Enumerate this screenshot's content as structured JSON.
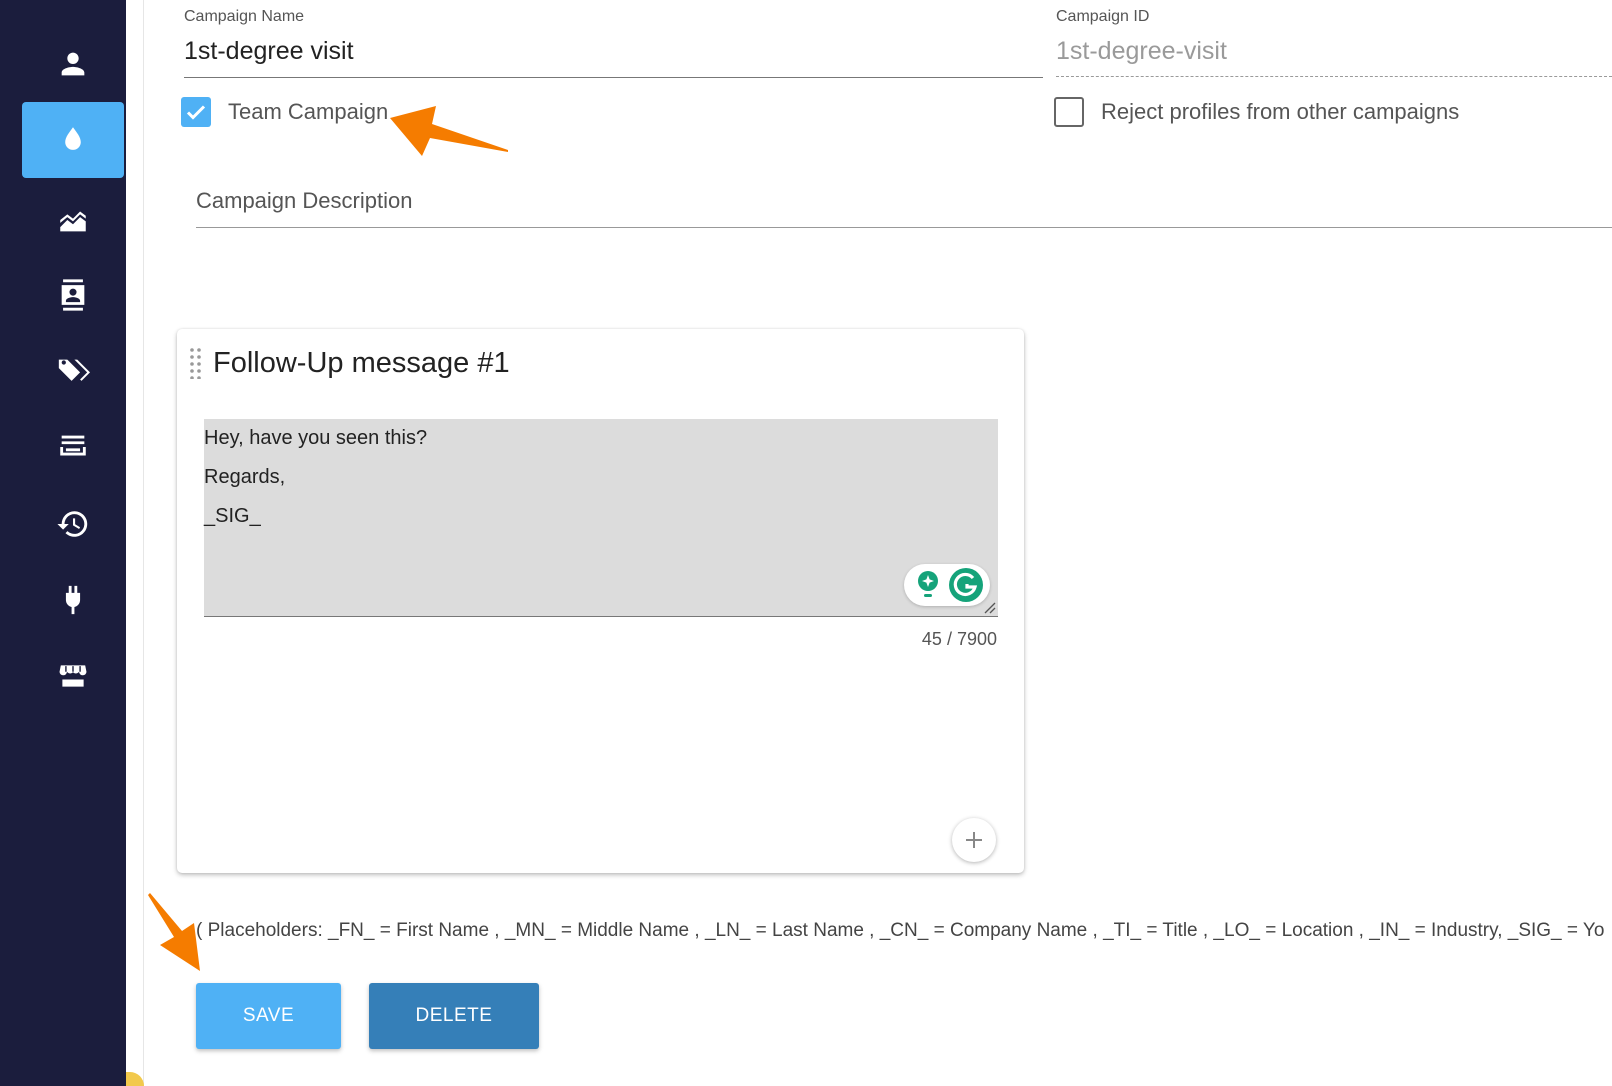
{
  "sidebar": {
    "items": [
      {
        "icon": "person-icon",
        "active": false
      },
      {
        "icon": "water-drop-icon",
        "active": true
      },
      {
        "icon": "area-chart-icon",
        "active": false
      },
      {
        "icon": "contacts-icon",
        "active": false
      },
      {
        "icon": "tags-icon",
        "active": false
      },
      {
        "icon": "list-stack-icon",
        "active": false
      },
      {
        "icon": "history-icon",
        "active": false
      },
      {
        "icon": "plug-icon",
        "active": false
      },
      {
        "icon": "storefront-icon",
        "active": false
      }
    ]
  },
  "form": {
    "campaign_name_label": "Campaign Name",
    "campaign_name_value": "1st-degree visit",
    "campaign_id_label": "Campaign ID",
    "campaign_id_value": "1st-degree-visit",
    "team_campaign_label": "Team Campaign",
    "team_campaign_checked": true,
    "reject_profiles_label": "Reject profiles from other campaigns",
    "reject_profiles_checked": false,
    "description_placeholder": "Campaign Description"
  },
  "followup": {
    "title": "Follow-Up message #1",
    "message_lines": [
      "Hey, have you seen this?",
      "Regards,",
      "_SIG_"
    ],
    "char_count": "45 / 7900"
  },
  "placeholders_text": "( Placeholders: _FN_ = First Name , _MN_ = Middle Name , _LN_ = Last Name , _CN_ = Company Name , _TI_ = Title , _LO_ = Location , _IN_ = Industry, _SIG_ = Yo",
  "actions": {
    "save_label": "SAVE",
    "delete_label": "DELETE"
  },
  "colors": {
    "sidebar_bg": "#1b1d3d",
    "accent": "#4fb1f5",
    "delete_button": "#357fb8",
    "annotation_arrow": "#f57c00"
  }
}
